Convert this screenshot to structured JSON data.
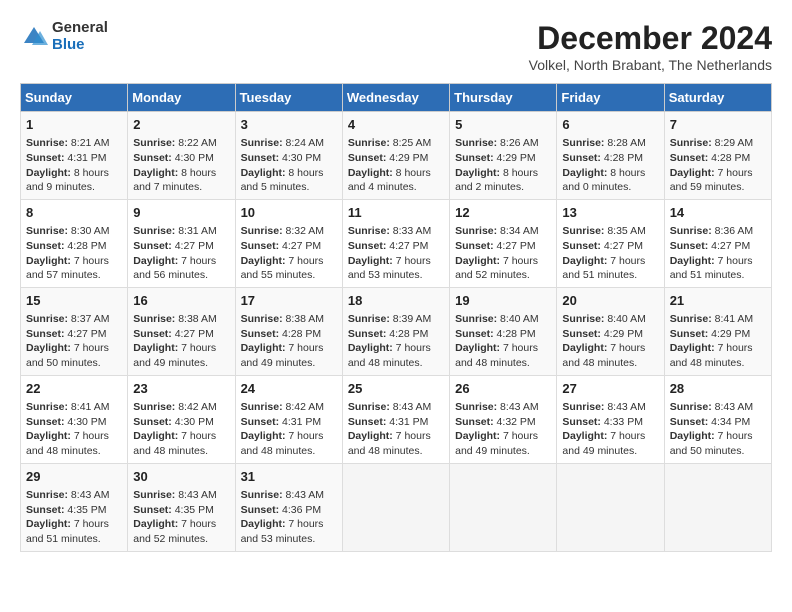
{
  "header": {
    "logo_line1": "General",
    "logo_line2": "Blue",
    "month_title": "December 2024",
    "location": "Volkel, North Brabant, The Netherlands"
  },
  "days_of_week": [
    "Sunday",
    "Monday",
    "Tuesday",
    "Wednesday",
    "Thursday",
    "Friday",
    "Saturday"
  ],
  "weeks": [
    [
      {
        "day": "1",
        "info": "Sunrise: 8:21 AM\nSunset: 4:31 PM\nDaylight: 8 hours and 9 minutes."
      },
      {
        "day": "2",
        "info": "Sunrise: 8:22 AM\nSunset: 4:30 PM\nDaylight: 8 hours and 7 minutes."
      },
      {
        "day": "3",
        "info": "Sunrise: 8:24 AM\nSunset: 4:30 PM\nDaylight: 8 hours and 5 minutes."
      },
      {
        "day": "4",
        "info": "Sunrise: 8:25 AM\nSunset: 4:29 PM\nDaylight: 8 hours and 4 minutes."
      },
      {
        "day": "5",
        "info": "Sunrise: 8:26 AM\nSunset: 4:29 PM\nDaylight: 8 hours and 2 minutes."
      },
      {
        "day": "6",
        "info": "Sunrise: 8:28 AM\nSunset: 4:28 PM\nDaylight: 8 hours and 0 minutes."
      },
      {
        "day": "7",
        "info": "Sunrise: 8:29 AM\nSunset: 4:28 PM\nDaylight: 7 hours and 59 minutes."
      }
    ],
    [
      {
        "day": "8",
        "info": "Sunrise: 8:30 AM\nSunset: 4:28 PM\nDaylight: 7 hours and 57 minutes."
      },
      {
        "day": "9",
        "info": "Sunrise: 8:31 AM\nSunset: 4:27 PM\nDaylight: 7 hours and 56 minutes."
      },
      {
        "day": "10",
        "info": "Sunrise: 8:32 AM\nSunset: 4:27 PM\nDaylight: 7 hours and 55 minutes."
      },
      {
        "day": "11",
        "info": "Sunrise: 8:33 AM\nSunset: 4:27 PM\nDaylight: 7 hours and 53 minutes."
      },
      {
        "day": "12",
        "info": "Sunrise: 8:34 AM\nSunset: 4:27 PM\nDaylight: 7 hours and 52 minutes."
      },
      {
        "day": "13",
        "info": "Sunrise: 8:35 AM\nSunset: 4:27 PM\nDaylight: 7 hours and 51 minutes."
      },
      {
        "day": "14",
        "info": "Sunrise: 8:36 AM\nSunset: 4:27 PM\nDaylight: 7 hours and 51 minutes."
      }
    ],
    [
      {
        "day": "15",
        "info": "Sunrise: 8:37 AM\nSunset: 4:27 PM\nDaylight: 7 hours and 50 minutes."
      },
      {
        "day": "16",
        "info": "Sunrise: 8:38 AM\nSunset: 4:27 PM\nDaylight: 7 hours and 49 minutes."
      },
      {
        "day": "17",
        "info": "Sunrise: 8:38 AM\nSunset: 4:28 PM\nDaylight: 7 hours and 49 minutes."
      },
      {
        "day": "18",
        "info": "Sunrise: 8:39 AM\nSunset: 4:28 PM\nDaylight: 7 hours and 48 minutes."
      },
      {
        "day": "19",
        "info": "Sunrise: 8:40 AM\nSunset: 4:28 PM\nDaylight: 7 hours and 48 minutes."
      },
      {
        "day": "20",
        "info": "Sunrise: 8:40 AM\nSunset: 4:29 PM\nDaylight: 7 hours and 48 minutes."
      },
      {
        "day": "21",
        "info": "Sunrise: 8:41 AM\nSunset: 4:29 PM\nDaylight: 7 hours and 48 minutes."
      }
    ],
    [
      {
        "day": "22",
        "info": "Sunrise: 8:41 AM\nSunset: 4:30 PM\nDaylight: 7 hours and 48 minutes."
      },
      {
        "day": "23",
        "info": "Sunrise: 8:42 AM\nSunset: 4:30 PM\nDaylight: 7 hours and 48 minutes."
      },
      {
        "day": "24",
        "info": "Sunrise: 8:42 AM\nSunset: 4:31 PM\nDaylight: 7 hours and 48 minutes."
      },
      {
        "day": "25",
        "info": "Sunrise: 8:43 AM\nSunset: 4:31 PM\nDaylight: 7 hours and 48 minutes."
      },
      {
        "day": "26",
        "info": "Sunrise: 8:43 AM\nSunset: 4:32 PM\nDaylight: 7 hours and 49 minutes."
      },
      {
        "day": "27",
        "info": "Sunrise: 8:43 AM\nSunset: 4:33 PM\nDaylight: 7 hours and 49 minutes."
      },
      {
        "day": "28",
        "info": "Sunrise: 8:43 AM\nSunset: 4:34 PM\nDaylight: 7 hours and 50 minutes."
      }
    ],
    [
      {
        "day": "29",
        "info": "Sunrise: 8:43 AM\nSunset: 4:35 PM\nDaylight: 7 hours and 51 minutes."
      },
      {
        "day": "30",
        "info": "Sunrise: 8:43 AM\nSunset: 4:35 PM\nDaylight: 7 hours and 52 minutes."
      },
      {
        "day": "31",
        "info": "Sunrise: 8:43 AM\nSunset: 4:36 PM\nDaylight: 7 hours and 53 minutes."
      },
      null,
      null,
      null,
      null
    ]
  ]
}
